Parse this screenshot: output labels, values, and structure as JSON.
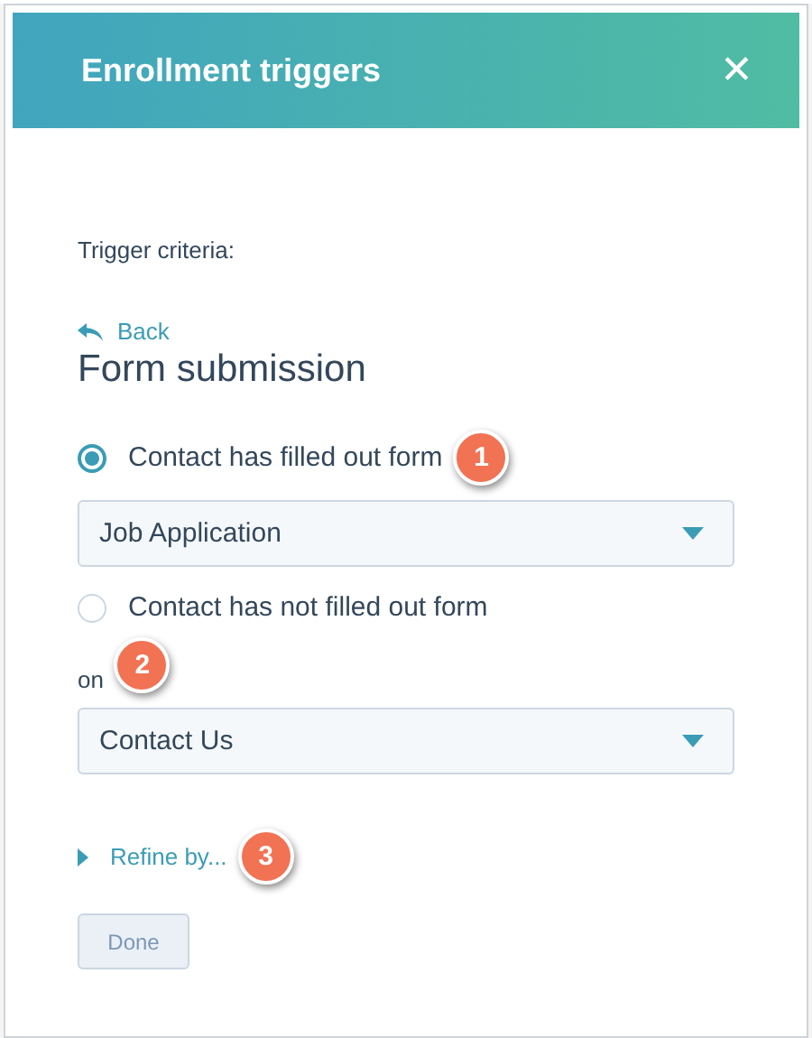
{
  "header": {
    "title": "Enrollment triggers",
    "close": "✕"
  },
  "criteria_label": "Trigger criteria:",
  "back": "Back",
  "heading": "Form submission",
  "options": [
    {
      "label": "Contact has filled out form",
      "selected": true,
      "badge": "1",
      "dropdown": "Job Application"
    },
    {
      "label": "Contact has not filled out form",
      "selected": false
    }
  ],
  "on": {
    "label": "on",
    "badge": "2",
    "dropdown": "Contact Us"
  },
  "refine": {
    "label": "Refine by...",
    "badge": "3",
    "expanded": false
  },
  "done": {
    "label": "Done",
    "disabled": true
  }
}
